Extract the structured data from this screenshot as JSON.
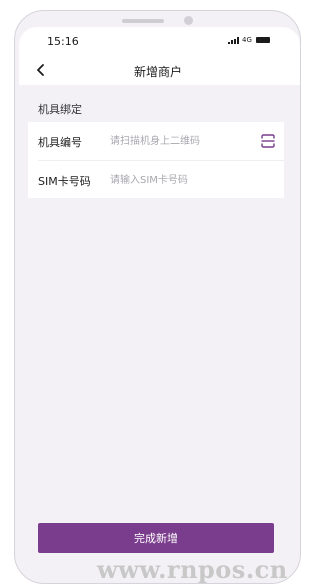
{
  "status_bar": {
    "time": "15:16",
    "network": "4G"
  },
  "header": {
    "title": "新增商户",
    "back_icon": "chevron-left-icon"
  },
  "section": {
    "label": "机具绑定"
  },
  "form": {
    "fields": [
      {
        "label": "机具编号",
        "value": "",
        "placeholder": "请扫描机身上二维码",
        "action_icon": "scan-icon"
      },
      {
        "label": "SIM卡号码",
        "value": "",
        "placeholder": "请输入SIM卡号码"
      }
    ]
  },
  "footer": {
    "submit_label": "完成新增"
  },
  "watermark": {
    "text": "www.rnpos.cn"
  },
  "colors": {
    "accent": "#7a3c8c",
    "background": "#f3f1f6",
    "card": "#ffffff",
    "placeholder": "#a9a7ae"
  }
}
